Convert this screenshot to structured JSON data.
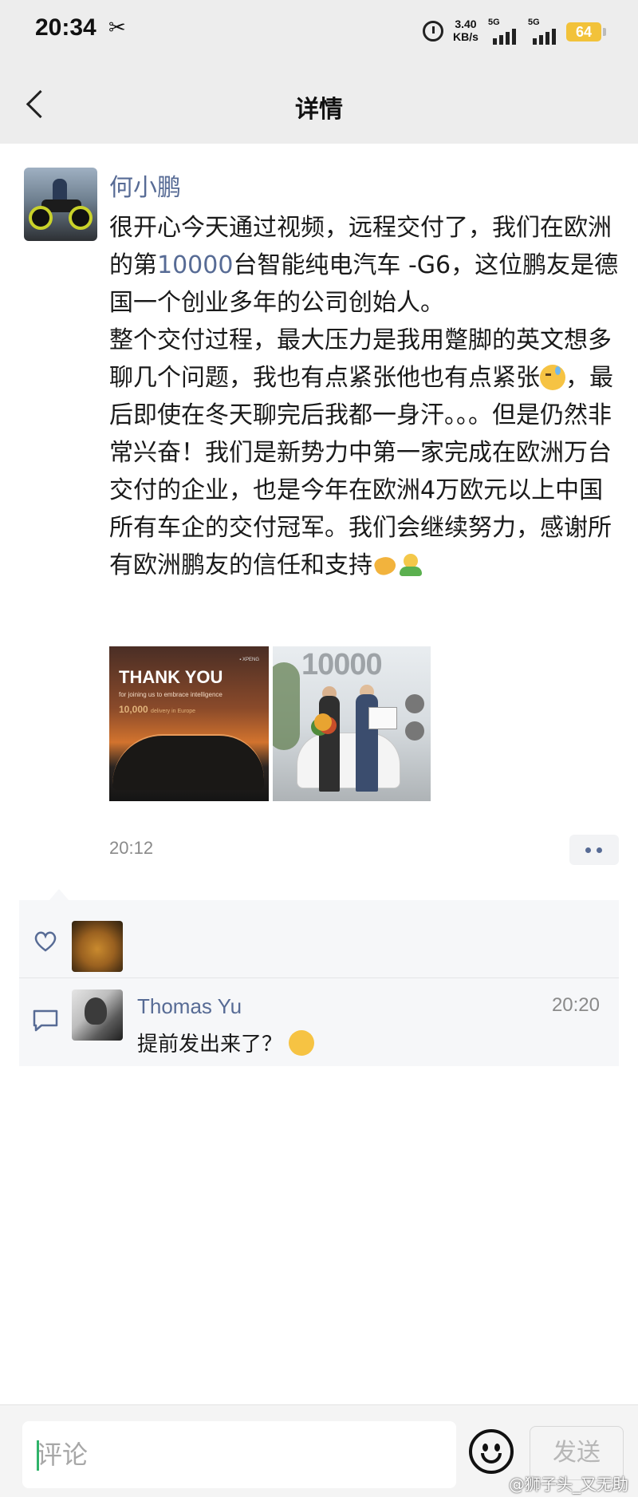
{
  "status_bar": {
    "time": "20:34",
    "network_speed": "3.40",
    "network_speed_unit": "KB/s",
    "signal1_label": "5G",
    "signal2_label": "5G",
    "battery": "64",
    "battery_color": "#f2c23a"
  },
  "header": {
    "title": "详情",
    "back_icon": "chevron-left-icon"
  },
  "post": {
    "author": "何小鹏",
    "text_p1_before": "很开心今天通过视频，远程交付了，我们在欧洲的第",
    "text_p1_highlight": "10000",
    "text_p1_after": "台智能纯电汽车 -G6，这位鹏友是德国一个创业多年的公司创始人。",
    "text_p2_a": "整个交付过程，最大压力是我用蹩脚的英文想多聊几个问题，我也有点紧张他也有点紧张",
    "text_p2_b": "，最后即使在冬天聊完后我都一身汗。。。但是仍然非常兴奋！我们是新势力中第一家完成在欧洲万台交付的企业，也是今年在欧洲4万欧元以上中国所有车企的交付冠军。我们会继续努力，感谢所有欧洲鹏友的信任和支持",
    "image1": {
      "title": "THANK YOU",
      "subtitle": "for joining us to embrace intelligence",
      "number": "10,000",
      "number_suffix": "delivery in Europe"
    },
    "image2": {
      "big_text": "10000"
    },
    "time": "20:12",
    "highlight_color": "#576b95",
    "link_color": "#576b95"
  },
  "interactions": {
    "comments": [
      {
        "author": "Thomas Yu",
        "time": "20:20",
        "text": "提前发出来了？"
      }
    ]
  },
  "bottom_bar": {
    "input_placeholder": "评论",
    "send_label": "发送",
    "emoji_icon": "smiley-face-icon"
  },
  "watermark": "@狮子头_又无助"
}
